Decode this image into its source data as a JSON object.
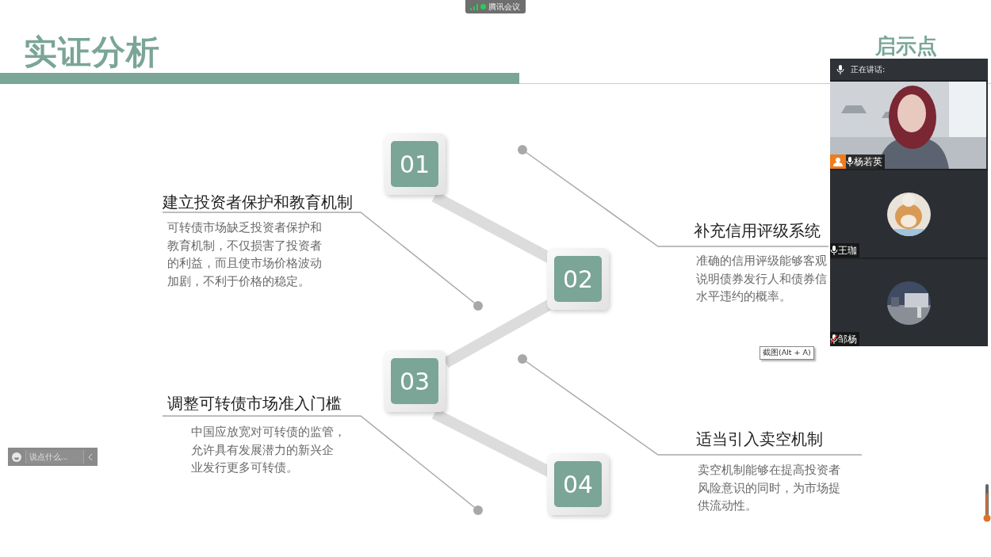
{
  "meeting_bar": {
    "app_name": "腾讯会议"
  },
  "slide": {
    "title": "实证分析",
    "corner_title": "启示点",
    "steps": [
      {
        "number": "01",
        "heading": "建立投资者保护和教育机制",
        "lines": [
          "可转债市场缺乏投资者保护和",
          "教育机制，不仅损害了投资者",
          "的利益，而且使市场价格波动",
          "加剧，不利于价格的稳定。"
        ]
      },
      {
        "number": "02",
        "heading": "补充信用评级系统",
        "lines": [
          "准确的信用评级能够客观",
          "说明债券发行人和债券信",
          "水平违约的概率。"
        ]
      },
      {
        "number": "03",
        "heading": "调整可转债市场准入门槛",
        "lines": [
          "中国应放宽对可转债的监管，",
          "允许具有发展潜力的新兴企",
          "业发行更多可转债。"
        ]
      },
      {
        "number": "04",
        "heading": "适当引入卖空机制",
        "lines": [
          "卖空机制能够在提高投资者",
          "风险意识的同时，为市场提",
          "供流动性。"
        ]
      }
    ]
  },
  "video_panel": {
    "speaking_label": "正在讲话:",
    "participants": [
      {
        "name": "杨若英",
        "kind": "video",
        "host": true,
        "muted": false
      },
      {
        "name": "王珈",
        "kind": "avatar",
        "host": false,
        "muted": false
      },
      {
        "name": "邹杨",
        "kind": "avatar",
        "host": false,
        "muted": true
      }
    ]
  },
  "chat_bar": {
    "placeholder": "说点什么..."
  },
  "tooltip": {
    "text": "截图(Alt + A)"
  }
}
